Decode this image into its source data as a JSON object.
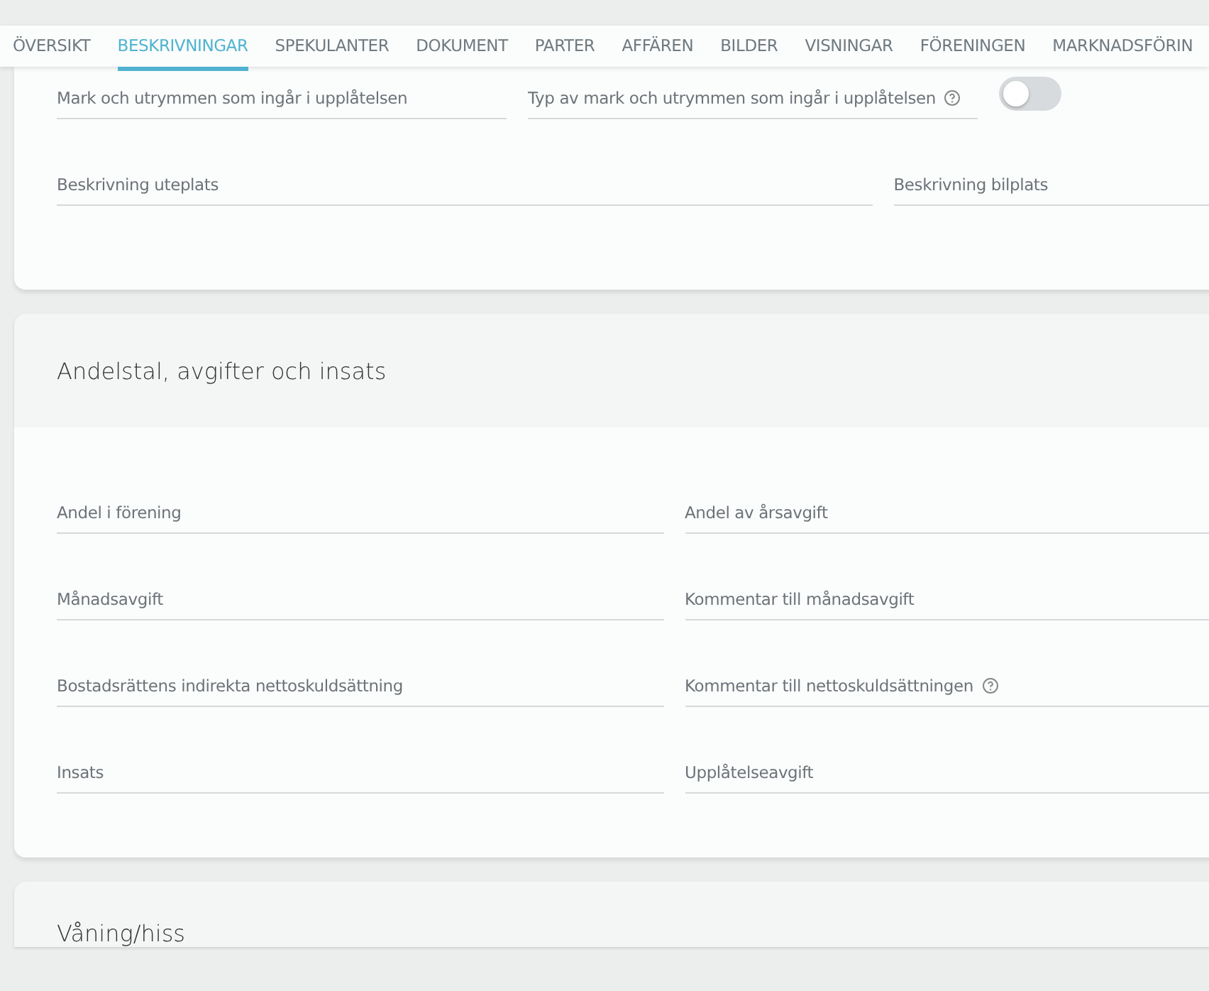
{
  "tabs": [
    {
      "label": "ÖVERSIKT",
      "selected": false
    },
    {
      "label": "BESKRIVNINGAR",
      "selected": true
    },
    {
      "label": "SPEKULANTER",
      "selected": false
    },
    {
      "label": "DOKUMENT",
      "selected": false
    },
    {
      "label": "PARTER",
      "selected": false
    },
    {
      "label": "AFFÄREN",
      "selected": false
    },
    {
      "label": "BILDER",
      "selected": false
    },
    {
      "label": "VISNINGAR",
      "selected": false
    },
    {
      "label": "FÖRENINGEN",
      "selected": false
    },
    {
      "label": "MARKNADSFÖRIN",
      "selected": false
    }
  ],
  "top_card": {
    "rows": [
      {
        "fields": [
          {
            "kind": "field",
            "placeholder": "Mark och utrymmen som ingår i upplåtelsen",
            "help": false
          },
          {
            "kind": "field",
            "placeholder": "Typ av mark och utrymmen som ingår i upplåtelsen",
            "help": true
          },
          {
            "kind": "toggle",
            "on": false
          }
        ]
      },
      {
        "fields": [
          {
            "kind": "wide",
            "placeholder": "Beskrivning uteplats",
            "help": false
          },
          {
            "kind": "field",
            "placeholder": "Beskrivning bilplats",
            "help": false
          }
        ]
      }
    ]
  },
  "sections": [
    {
      "title": "Andelstal, avgifter och insats",
      "rows": [
        {
          "fields": [
            {
              "placeholder": "Andel i förening",
              "help": false
            },
            {
              "placeholder": "Andel av årsavgift",
              "help": false
            }
          ]
        },
        {
          "fields": [
            {
              "placeholder": "Månadsavgift",
              "help": false
            },
            {
              "placeholder": "Kommentar till månadsavgift",
              "help": false
            }
          ]
        },
        {
          "fields": [
            {
              "placeholder": "Bostadsrättens indirekta nettoskuldsättning",
              "help": false
            },
            {
              "placeholder": "Kommentar till nettoskuldsättningen",
              "help": true
            }
          ]
        },
        {
          "fields": [
            {
              "placeholder": "Insats",
              "help": false
            },
            {
              "placeholder": "Upplåtelseavgift",
              "help": false
            }
          ]
        }
      ]
    },
    {
      "title": "Våning/hiss"
    }
  ]
}
